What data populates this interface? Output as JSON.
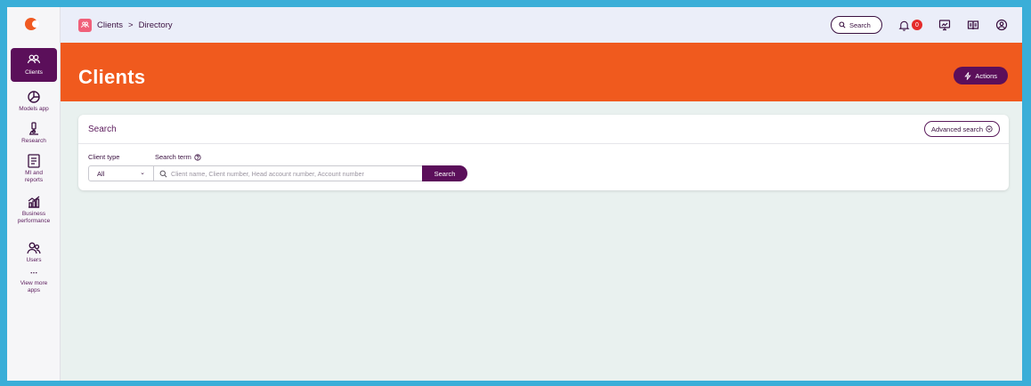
{
  "colors": {
    "brand_orange": "#f05a1e",
    "brand_purple": "#5b0f5a",
    "badge_red": "#e52b2b",
    "frame_blue": "#3aaed8"
  },
  "rail": {
    "logo": "brand-logo",
    "items": [
      {
        "label": "Clients",
        "icon": "users-icon",
        "active": true
      },
      {
        "label": "Models app",
        "icon": "pie-chart-icon"
      },
      {
        "label": "Research",
        "icon": "microscope-icon"
      },
      {
        "label": "MI and reports",
        "icon": "report-icon"
      },
      {
        "label": "Business performance",
        "icon": "bar-growth-icon"
      },
      {
        "label": "Users",
        "icon": "user-group-icon"
      },
      {
        "label": "View more apps",
        "icon": "more-dots-icon"
      }
    ]
  },
  "topbar": {
    "breadcrumb": [
      "Clients",
      "Directory"
    ],
    "separator": ">",
    "search_label": "Search",
    "notification_count": "0"
  },
  "banner": {
    "title": "Clients",
    "actions_label": "Actions"
  },
  "search_card": {
    "title": "Search",
    "advanced_label": "Advanced search",
    "client_type_label": "Client type",
    "client_type_value": "All",
    "search_term_label": "Search term",
    "search_placeholder": "Client name, Client number, Head account number, Account number",
    "search_button": "Search"
  }
}
